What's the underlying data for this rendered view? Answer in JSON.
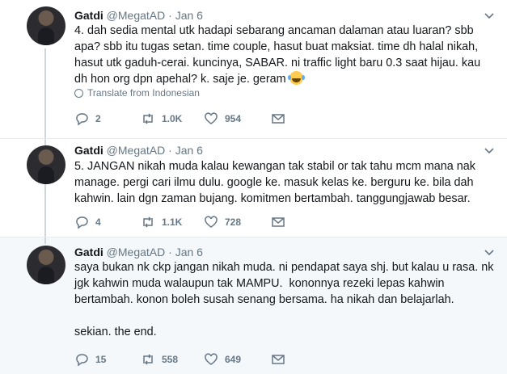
{
  "colors": {
    "text": "#14171a",
    "muted": "#657786",
    "highlight_bg": "#f5f8fa",
    "thread_line": "#ccd6dd"
  },
  "tweets": [
    {
      "name": "Gatdi",
      "handle": "@MegatAD",
      "dot": "·",
      "date": "Jan 6",
      "text": "4. dah sedia mental utk hadapi sebarang ancaman dalaman atau luaran? sbb apa? sbb itu tugas setan. time couple, hasut buat maksiat. time dh halal nikah, hasut utk gaduh-cerai. kuncinya, SABAR. ni traffic light baru 0.3 saat hijau. kau dh hon org dpn apehal? k. saje je. geram",
      "emoji": "face-with-tears-of-joy",
      "translate": "Translate from Indonesian",
      "replies": "2",
      "retweets": "1.0K",
      "likes": "954"
    },
    {
      "name": "Gatdi",
      "handle": "@MegatAD",
      "dot": "·",
      "date": "Jan 6",
      "text": "5. JANGAN nikah muda kalau kewangan tak stabil or tak tahu mcm mana nak manage. pergi cari ilmu dulu. google ke. masuk kelas ke. berguru ke. bila dah kahwin. lain dgn zaman bujang. komitmen bertambah. tanggungjawab besar.",
      "replies": "4",
      "retweets": "1.1K",
      "likes": "728"
    },
    {
      "name": "Gatdi",
      "handle": "@MegatAD",
      "dot": "·",
      "date": "Jan 6",
      "text": "saya bukan nk ckp jangan nikah muda. ni pendapat saya shj. but kalau u rasa. nk jgk kahwin muda walaupun tak MAMPU.  kononnya rezeki lepas kahwin bertambah. konon boleh susah senang bersama. ha nikah dan belajarlah.\n\nsekian. the end.",
      "replies": "15",
      "retweets": "558",
      "likes": "649"
    }
  ]
}
